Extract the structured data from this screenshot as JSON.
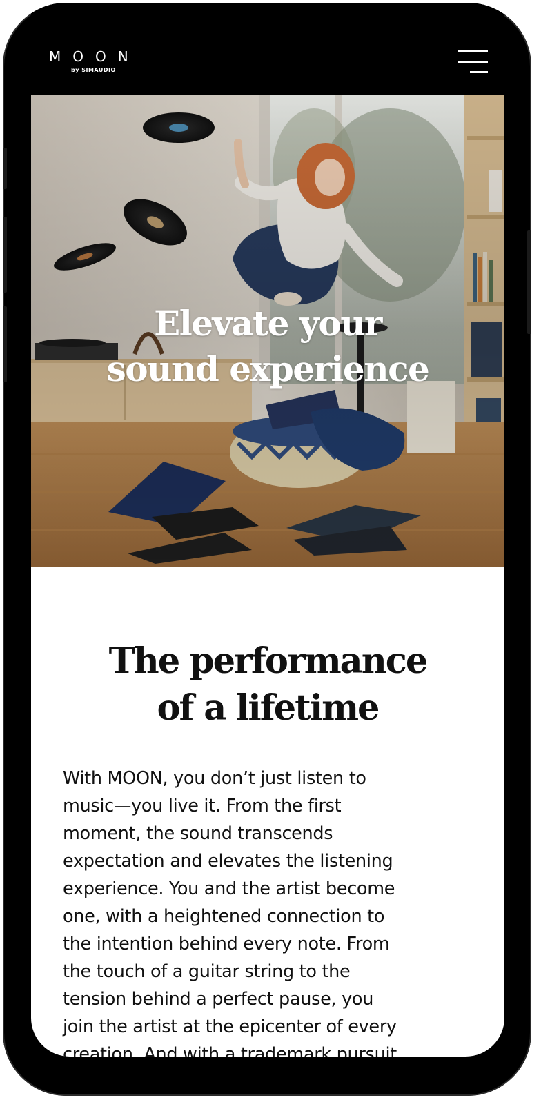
{
  "brand": {
    "name": "MOON",
    "tagline": "by SIMAUDIO"
  },
  "header": {
    "menu_icon": "hamburger-menu-icon"
  },
  "hero": {
    "title_lines": [
      "Elevate your",
      "sound experience"
    ]
  },
  "section": {
    "title_lines": [
      "The performance",
      "of a lifetime"
    ],
    "body_lines": [
      "With MOON, you don’t just listen to",
      "music—you live it. From the first",
      "moment, the sound transcends",
      "expectation and elevates the listening",
      "experience. You and the artist become",
      "one, with a heightened connection to",
      "the intention behind every note. From",
      "the touch of a guitar string to the",
      "tension behind a perfect pause, you",
      "join the artist at the epicenter of every",
      "creation. And with a trademark pursuit"
    ]
  },
  "colors": {
    "device_frame": "#000000",
    "header_bg": "#000000",
    "content_bg": "#ffffff",
    "text": "#111111"
  }
}
